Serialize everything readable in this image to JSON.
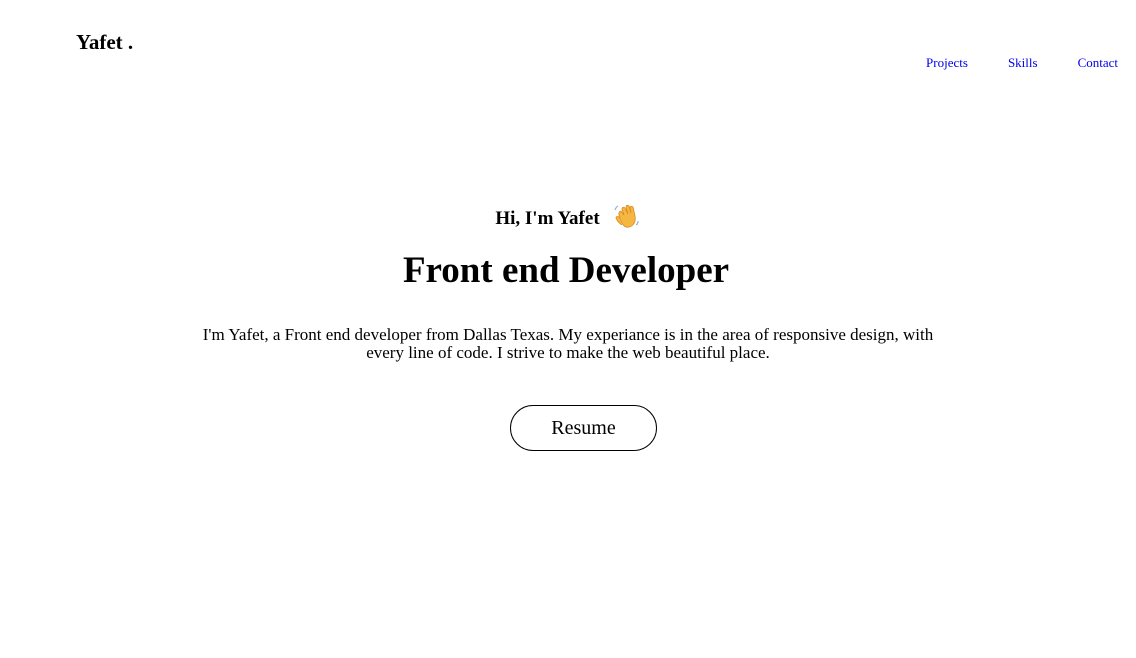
{
  "header": {
    "logo": "Yafet ."
  },
  "nav": {
    "items": [
      {
        "label": "Projects"
      },
      {
        "label": "Skills"
      },
      {
        "label": "Contact"
      }
    ],
    "link_color": "#0000ee"
  },
  "hero": {
    "greeting": "Hi, I'm Yafet",
    "greeting_icon": "waving-hand-icon",
    "title": "Front end Developer",
    "intro": "I'm Yafet, a Front end developer from Dallas Texas. My experiance is in the area of responsive design, with every line of code. I strive to make the web beautiful place.",
    "resume_label": "Resume"
  }
}
